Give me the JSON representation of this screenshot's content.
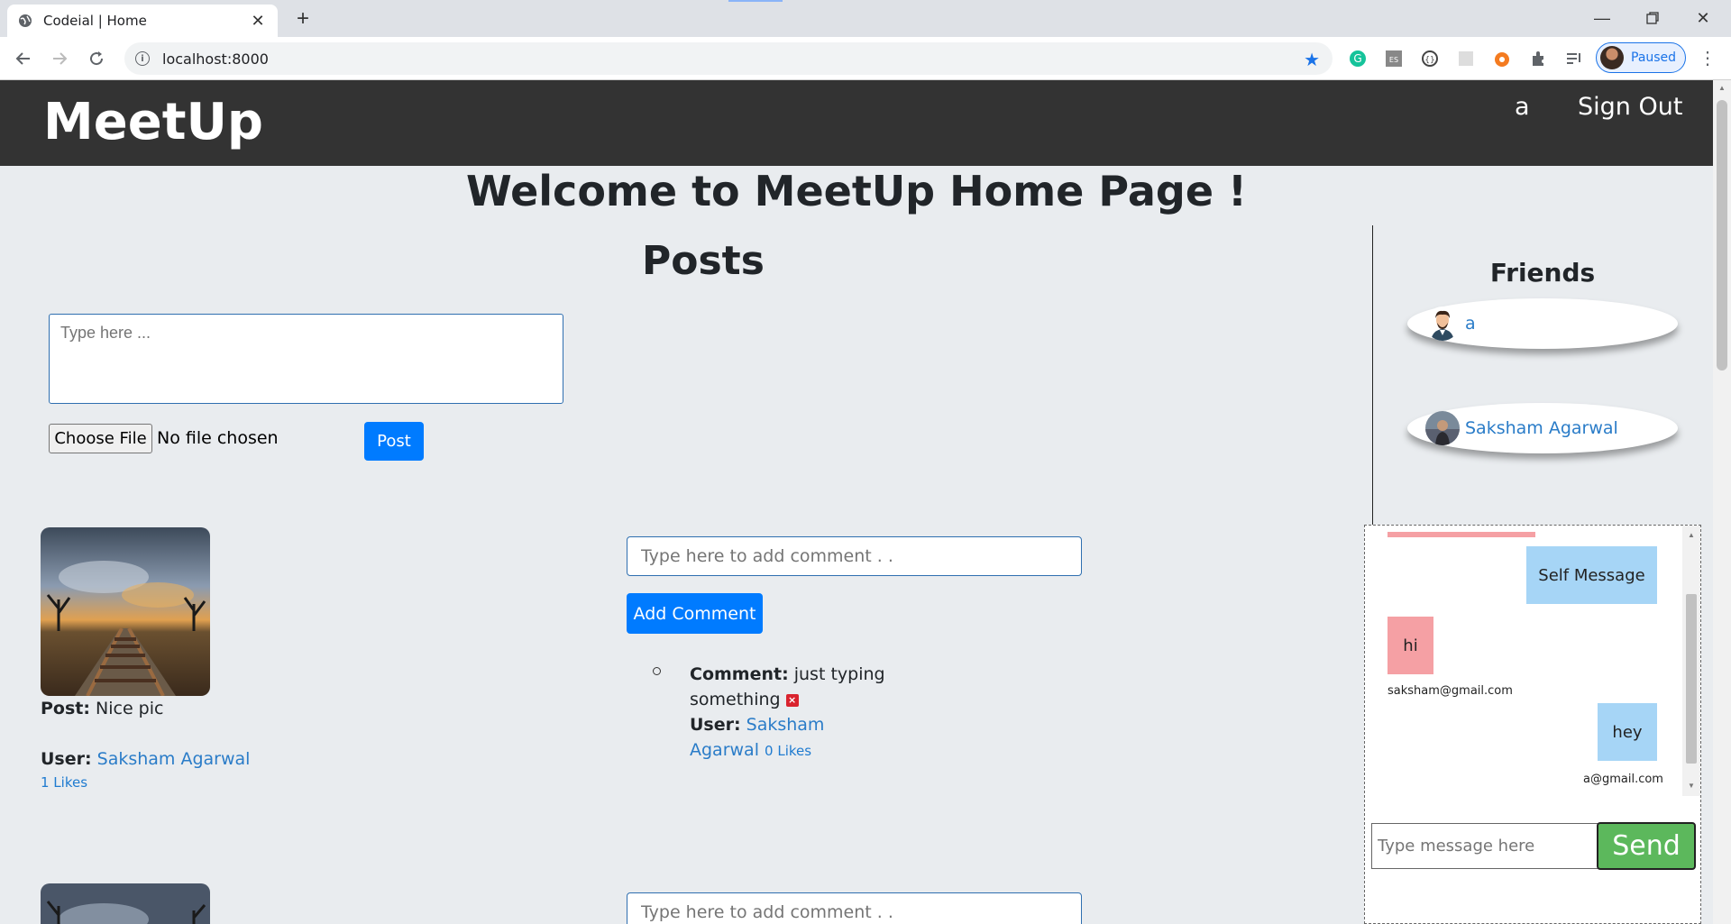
{
  "browser": {
    "tab_title": "Codeial | Home",
    "url": "localhost:8000",
    "profile_label": "Paused"
  },
  "header": {
    "brand": "MeetUp",
    "user_link": "a",
    "signout_link": "Sign Out"
  },
  "main": {
    "welcome": "Welcome to MeetUp Home Page !",
    "posts_heading": "Posts",
    "post_form": {
      "textarea_placeholder": "Type here ...",
      "file_button": "Choose File",
      "file_status": "No file chosen",
      "post_button": "Post"
    },
    "posts": [
      {
        "post_label": "Post:",
        "content": "Nice pic",
        "user_label": "User:",
        "user": "Saksham Agarwal",
        "likes": "1 Likes",
        "comment_placeholder": "Type here to add comment . .",
        "comment_button": "Add Comment",
        "comments": [
          {
            "comment_label": "Comment:",
            "content": "just typing something",
            "user_label": "User:",
            "user": "Saksham Agarwal",
            "likes": "0 Likes"
          }
        ]
      },
      {
        "comment_placeholder": "Type here to add comment . ."
      }
    ]
  },
  "friends": {
    "heading": "Friends",
    "items": [
      {
        "name": "a"
      },
      {
        "name": "Saksham Agarwal"
      }
    ]
  },
  "chat": {
    "messages": [
      {
        "type": "self",
        "text": "Self Message"
      },
      {
        "type": "other",
        "text": "hi",
        "email": "saksham@gmail.com"
      },
      {
        "type": "self",
        "text": "hey",
        "email": "a@gmail.com"
      }
    ],
    "input_placeholder": "Type message here",
    "send_button": "Send"
  },
  "colors": {
    "header_bg": "#333333",
    "page_bg": "#e9ecef",
    "primary": "#007bff",
    "self_msg": "#a6d5f6",
    "other_msg": "#f5a0a4",
    "send_btn": "#5cb85c"
  }
}
